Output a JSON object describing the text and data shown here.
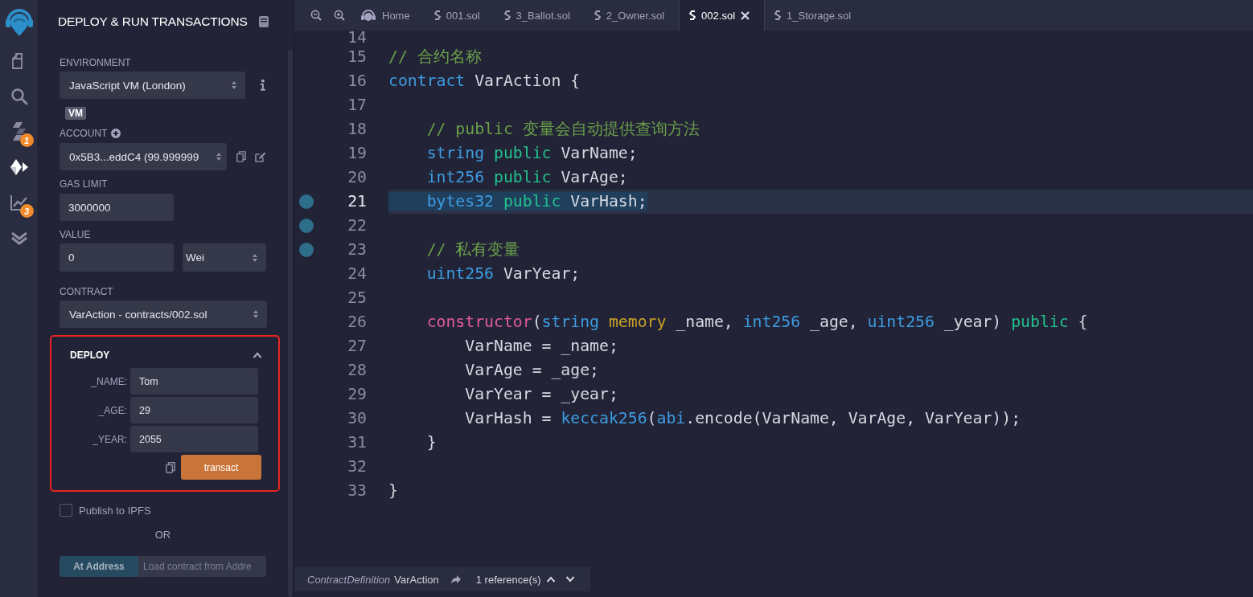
{
  "rail": {
    "items": [
      {
        "kind": "files",
        "selected": false
      },
      {
        "kind": "search",
        "selected": false
      },
      {
        "kind": "compiler",
        "selected": false,
        "badge": "1"
      },
      {
        "kind": "deploy",
        "selected": true
      },
      {
        "kind": "analysis",
        "selected": false,
        "badge": "3"
      },
      {
        "kind": "tests",
        "selected": false
      }
    ]
  },
  "panel": {
    "title": "DEPLOY & RUN TRANSACTIONS",
    "environment": {
      "label": "ENVIRONMENT",
      "value": "JavaScript VM (London)",
      "badge": "VM"
    },
    "account": {
      "label": "ACCOUNT",
      "value": "0x5B3...eddC4 (99.999999"
    },
    "gas_limit": {
      "label": "GAS LIMIT",
      "value": "3000000"
    },
    "value": {
      "label": "VALUE",
      "amount": "0",
      "unit": "Wei"
    },
    "contract": {
      "label": "CONTRACT",
      "value": "VarAction - contracts/002.sol"
    },
    "deploy": {
      "title": "DEPLOY",
      "expanded": true,
      "params": [
        {
          "label": "_NAME:",
          "value": "Tom"
        },
        {
          "label": "_AGE:",
          "value": "29"
        },
        {
          "label": "_YEAR:",
          "value": "2055"
        }
      ],
      "button": "transact"
    },
    "publish": {
      "label": "Publish to IPFS",
      "checked": false
    },
    "or": "OR",
    "at_address": {
      "button": "At Address",
      "placeholder": "Load contract from Addre"
    }
  },
  "tabs": [
    {
      "kind": "home",
      "label": "Home",
      "selected": false
    },
    {
      "kind": "file",
      "label": "001.sol",
      "selected": false
    },
    {
      "kind": "file",
      "label": "3_Ballot.sol",
      "selected": false
    },
    {
      "kind": "file",
      "label": "2_Owner.sol",
      "selected": false
    },
    {
      "kind": "file",
      "label": "002.sol",
      "selected": true
    },
    {
      "kind": "file",
      "label": "1_Storage.sol",
      "selected": false
    }
  ],
  "editor": {
    "lines": [
      {
        "number": "14",
        "breakpoint": false,
        "highlighted": false
      },
      {
        "number": "15",
        "breakpoint": false,
        "highlighted": false,
        "tokens": [
          {
            "kind": "comment",
            "text": "// 合约名称"
          }
        ]
      },
      {
        "number": "16",
        "breakpoint": false,
        "highlighted": false,
        "tokens": [
          {
            "kind": "keyword",
            "text": "contract"
          },
          {
            "kind": "plain",
            "text": " VarAction {"
          }
        ]
      },
      {
        "number": "17",
        "breakpoint": false,
        "highlighted": false
      },
      {
        "number": "18",
        "breakpoint": false,
        "highlighted": false,
        "tokens": [
          {
            "kind": "comment",
            "text": "    // public 变量会自动提供查询方法"
          }
        ]
      },
      {
        "number": "19",
        "breakpoint": false,
        "highlighted": false,
        "tokens": [
          {
            "kind": "keyword",
            "text": "    string"
          },
          {
            "kind": "modifier",
            "text": " public"
          },
          {
            "kind": "plain",
            "text": " VarName;"
          }
        ]
      },
      {
        "number": "20",
        "breakpoint": false,
        "highlighted": false,
        "tokens": [
          {
            "kind": "keyword",
            "text": "    int256"
          },
          {
            "kind": "modifier",
            "text": " public"
          },
          {
            "kind": "plain",
            "text": " VarAge;"
          }
        ]
      },
      {
        "number": "21",
        "breakpoint": true,
        "highlighted": true,
        "tokens": [
          {
            "kind": "keyword",
            "text": "    bytes32"
          },
          {
            "kind": "modifier",
            "text": " public"
          },
          {
            "kind": "plain",
            "text": " VarHash;"
          }
        ]
      },
      {
        "number": "22",
        "breakpoint": true,
        "highlighted": false
      },
      {
        "number": "23",
        "breakpoint": true,
        "highlighted": false,
        "tokens": [
          {
            "kind": "comment",
            "text": "    // 私有变量"
          }
        ]
      },
      {
        "number": "24",
        "breakpoint": false,
        "highlighted": false,
        "tokens": [
          {
            "kind": "keyword",
            "text": "    uint256"
          },
          {
            "kind": "plain",
            "text": " VarYear;"
          }
        ]
      },
      {
        "number": "25",
        "breakpoint": false,
        "highlighted": false
      },
      {
        "number": "26",
        "breakpoint": false,
        "highlighted": false,
        "tokens": [
          {
            "kind": "constructor",
            "text": "    constructor"
          },
          {
            "kind": "plain",
            "text": "("
          },
          {
            "kind": "keyword",
            "text": "string"
          },
          {
            "kind": "storage",
            "text": " memory"
          },
          {
            "kind": "plain",
            "text": " _name, "
          },
          {
            "kind": "keyword",
            "text": "int256"
          },
          {
            "kind": "plain",
            "text": " _age, "
          },
          {
            "kind": "keyword",
            "text": "uint256"
          },
          {
            "kind": "plain",
            "text": " _year) "
          },
          {
            "kind": "modifier",
            "text": "public"
          },
          {
            "kind": "plain",
            "text": " {"
          }
        ]
      },
      {
        "number": "27",
        "breakpoint": false,
        "highlighted": false,
        "tokens": [
          {
            "kind": "plain",
            "text": "        VarName = _name;"
          }
        ]
      },
      {
        "number": "28",
        "breakpoint": false,
        "highlighted": false,
        "tokens": [
          {
            "kind": "plain",
            "text": "        VarAge = _age;"
          }
        ]
      },
      {
        "number": "29",
        "breakpoint": false,
        "highlighted": false,
        "tokens": [
          {
            "kind": "plain",
            "text": "        VarYear = _year;"
          }
        ]
      },
      {
        "number": "30",
        "breakpoint": false,
        "highlighted": false,
        "tokens": [
          {
            "kind": "plain",
            "text": "        VarHash = "
          },
          {
            "kind": "builtin",
            "text": "keccak256"
          },
          {
            "kind": "plain",
            "text": "("
          },
          {
            "kind": "builtin",
            "text": "abi"
          },
          {
            "kind": "plain",
            "text": ".encode(VarName, VarAge, VarYear));"
          }
        ]
      },
      {
        "number": "31",
        "breakpoint": false,
        "highlighted": false,
        "tokens": [
          {
            "kind": "plain",
            "text": "    }"
          }
        ]
      },
      {
        "number": "32",
        "breakpoint": false,
        "highlighted": false
      },
      {
        "number": "33",
        "breakpoint": false,
        "highlighted": false,
        "tokens": [
          {
            "kind": "plain",
            "text": "}"
          }
        ]
      }
    ]
  },
  "status": {
    "node_type": "ContractDefinition",
    "name": "VarAction",
    "references": "1 reference(s)"
  }
}
